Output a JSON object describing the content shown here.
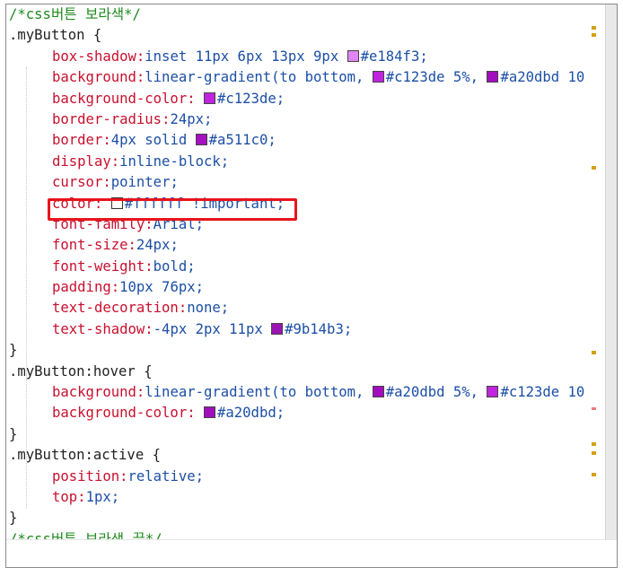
{
  "editor": {
    "language": "css",
    "lines": [
      {
        "kind": "comment",
        "text": "/*css버튼 보라색*/"
      },
      {
        "kind": "selector",
        "selector": ".myButton",
        "brace": " {"
      },
      {
        "kind": "decl",
        "prop": "box-shadow",
        "value": "inset 11px 6px 13px 9px ",
        "swatch": "#e184f3",
        "after": "#e184f3;"
      },
      {
        "kind": "decl",
        "prop": "background",
        "value": "linear-gradient(to bottom, ",
        "swatch": "#c123de",
        "after": "#c123de 5%, ",
        "swatch2": "#a20dbd",
        "after2": "#a20dbd 10"
      },
      {
        "kind": "decl",
        "prop": "background-color",
        "value": " ",
        "swatch": "#c123de",
        "after": "#c123de;"
      },
      {
        "kind": "decl",
        "prop": "border-radius",
        "value": "24px;"
      },
      {
        "kind": "decl",
        "prop": "border",
        "value": "4px solid ",
        "swatch": "#a511c0",
        "after": "#a511c0;"
      },
      {
        "kind": "decl",
        "prop": "display",
        "value": "inline-block;"
      },
      {
        "kind": "decl",
        "prop": "cursor",
        "value": "pointer;"
      },
      {
        "kind": "decl",
        "prop": "color",
        "value": " ",
        "swatch": "#ffffff",
        "after": "#ffffff !important;"
      },
      {
        "kind": "decl",
        "prop": "font-family",
        "value": "Arial;"
      },
      {
        "kind": "decl",
        "prop": "font-size",
        "value": "24px;"
      },
      {
        "kind": "decl",
        "prop": "font-weight",
        "value": "bold;"
      },
      {
        "kind": "decl",
        "prop": "padding",
        "value": "10px 76px;"
      },
      {
        "kind": "decl",
        "prop": "text-decoration",
        "value": "none;"
      },
      {
        "kind": "decl",
        "prop": "text-shadow",
        "value": "-4px 2px 11px ",
        "swatch": "#9b14b3",
        "after": "#9b14b3;"
      },
      {
        "kind": "close",
        "text": "}"
      },
      {
        "kind": "selector",
        "selector": ".myButton:hover",
        "brace": " {"
      },
      {
        "kind": "decl",
        "prop": "background",
        "value": "linear-gradient(to bottom, ",
        "swatch": "#a20dbd",
        "after": "#a20dbd 5%, ",
        "swatch2": "#c123de",
        "after2": "#c123de 10"
      },
      {
        "kind": "decl",
        "prop": "background-color",
        "value": " ",
        "swatch": "#a20dbd",
        "after": "#a20dbd;"
      },
      {
        "kind": "close",
        "text": "}"
      },
      {
        "kind": "selector",
        "selector": ".myButton:active",
        "brace": " {"
      },
      {
        "kind": "decl",
        "prop": "position",
        "value": "relative;"
      },
      {
        "kind": "decl",
        "prop": "top",
        "value": "1px;"
      },
      {
        "kind": "close",
        "text": "}"
      },
      {
        "kind": "comment",
        "text": "/*css버튼 보라색 끝*/"
      }
    ],
    "highlighted_line_index": 9
  },
  "colors": {
    "highlight_border": "#e8141c",
    "comment": "#1e8a1e",
    "property": "#c8102e",
    "value": "#1c4fa5",
    "overview_mark": "#d4a017"
  }
}
